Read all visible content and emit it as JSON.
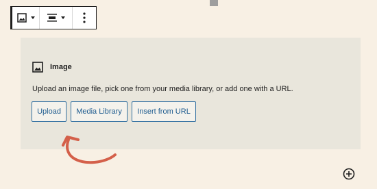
{
  "toolbar": {
    "icons": [
      "image-icon",
      "chevron-down-icon",
      "align-center-icon",
      "chevron-down-icon",
      "more-vertical-icon"
    ]
  },
  "block": {
    "title": "Image",
    "instructions": "Upload an image file, pick one from your media library, or add one with a URL.",
    "buttons": {
      "upload": "Upload",
      "media_library": "Media Library",
      "insert_url": "Insert from URL"
    }
  },
  "colors": {
    "background": "#f8f0e4",
    "placeholder": "#e9e6dc",
    "button_border": "#2f6ea0",
    "button_text": "#1d5b8f",
    "annotation_arrow": "#d4604a"
  },
  "icons": {
    "add_block": "plus-circle-icon",
    "annotation": "curved-arrow-icon"
  }
}
